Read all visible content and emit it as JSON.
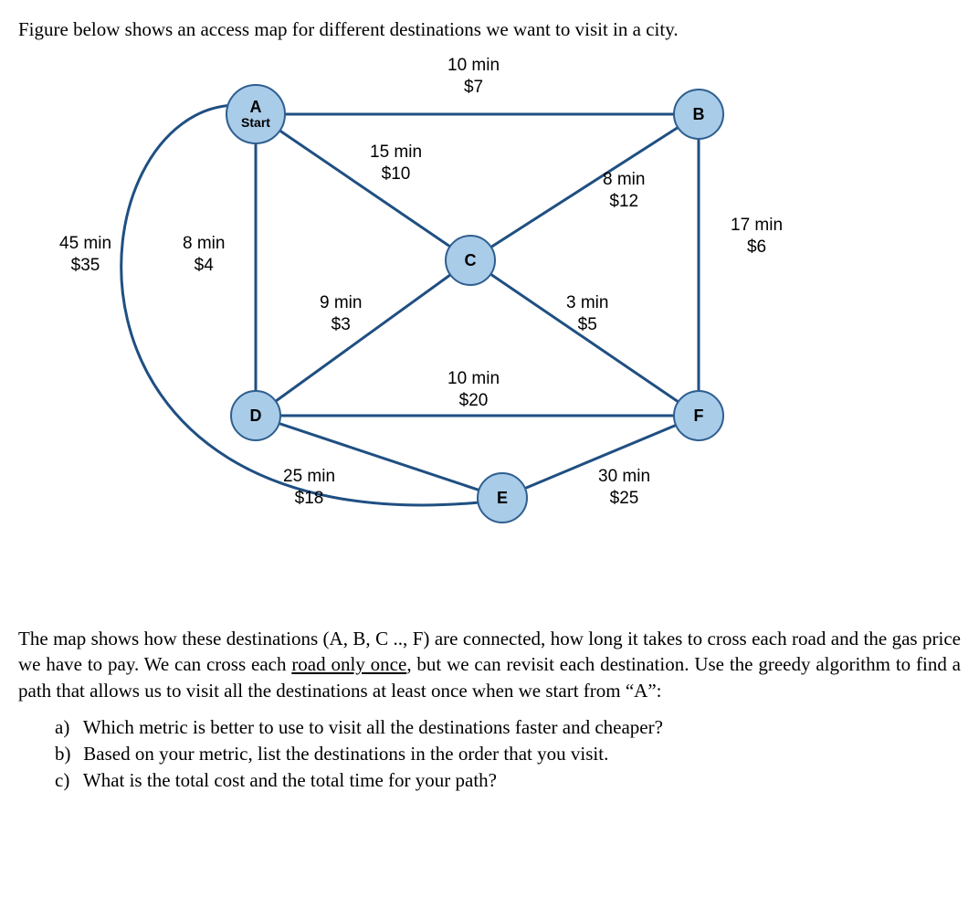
{
  "intro_text": "Figure below shows an access map for different destinations we want to visit in a city.",
  "nodes": {
    "A": {
      "label_top": "A",
      "label_bottom": "Start"
    },
    "B": {
      "label": "B"
    },
    "C": {
      "label": "C"
    },
    "D": {
      "label": "D"
    },
    "E": {
      "label": "E"
    },
    "F": {
      "label": "F"
    }
  },
  "edges": {
    "AB": {
      "time": "10 min",
      "cost": "$7"
    },
    "AC": {
      "time": "15 min",
      "cost": "$10"
    },
    "AD": {
      "time": "8 min",
      "cost": "$4"
    },
    "AE_curve": {
      "time": "45 min",
      "cost": "$35"
    },
    "BC": {
      "time": "8 min",
      "cost": "$12"
    },
    "BF": {
      "time": "17 min",
      "cost": "$6"
    },
    "CD": {
      "time": "9 min",
      "cost": "$3"
    },
    "CF": {
      "time": "3 min",
      "cost": "$5"
    },
    "DF": {
      "time": "10 min",
      "cost": "$20"
    },
    "DE": {
      "time": "25 min",
      "cost": "$18"
    },
    "EF": {
      "time": "30 min",
      "cost": "$25"
    }
  },
  "description_parts": {
    "p1": "The map shows how these destinations (A, B, C .., F) are connected, how long it takes to cross each road and the gas price we have to pay. We can cross each ",
    "underlined": "road only once",
    "p2": ", but we can revisit each destination. Use the greedy algorithm to find a path that allows us to visit all the destinations at least once when we start from “A”:"
  },
  "questions": {
    "a": {
      "label": "a)",
      "text": "Which metric is better to use to visit all the destinations faster and cheaper?"
    },
    "b": {
      "label": "b)",
      "text": "Based on your metric, list the destinations in the order that you visit."
    },
    "c": {
      "label": "c)",
      "text": "What is the total cost and the total time for your path?"
    }
  },
  "chart_data": {
    "type": "graph",
    "directed": false,
    "nodes": [
      "A",
      "B",
      "C",
      "D",
      "E",
      "F"
    ],
    "start_node": "A",
    "edges": [
      {
        "u": "A",
        "v": "B",
        "time_min": 10,
        "cost_usd": 7
      },
      {
        "u": "A",
        "v": "C",
        "time_min": 15,
        "cost_usd": 10
      },
      {
        "u": "A",
        "v": "D",
        "time_min": 8,
        "cost_usd": 4
      },
      {
        "u": "A",
        "v": "E",
        "time_min": 45,
        "cost_usd": 35
      },
      {
        "u": "B",
        "v": "C",
        "time_min": 8,
        "cost_usd": 12
      },
      {
        "u": "B",
        "v": "F",
        "time_min": 17,
        "cost_usd": 6
      },
      {
        "u": "C",
        "v": "D",
        "time_min": 9,
        "cost_usd": 3
      },
      {
        "u": "C",
        "v": "F",
        "time_min": 3,
        "cost_usd": 5
      },
      {
        "u": "D",
        "v": "F",
        "time_min": 10,
        "cost_usd": 20
      },
      {
        "u": "D",
        "v": "E",
        "time_min": 25,
        "cost_usd": 18
      },
      {
        "u": "E",
        "v": "F",
        "time_min": 30,
        "cost_usd": 25
      }
    ]
  }
}
